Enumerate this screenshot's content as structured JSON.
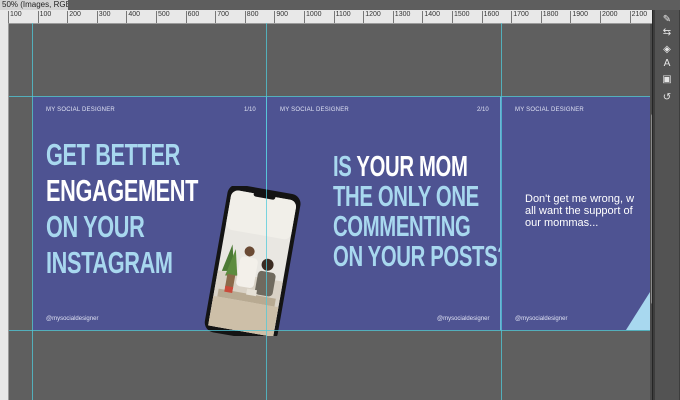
{
  "document_tab": {
    "title": "50% (Images, RGB/8*) *"
  },
  "ruler": {
    "labels": [
      "100",
      "100",
      "200",
      "300",
      "400",
      "500",
      "600",
      "700",
      "800",
      "900",
      "1000",
      "1100",
      "1200",
      "1300",
      "1400",
      "1500",
      "1600",
      "1700",
      "1800",
      "1900",
      "2000",
      "2100"
    ]
  },
  "slides": [
    {
      "brand": "MY SOCIAL DESIGNER",
      "page": "1/10",
      "headline": [
        "GET BETTER",
        "ENGAGEMENT",
        "ON YOUR",
        "INSTAGRAM"
      ],
      "handle": "@mysocialdesigner"
    },
    {
      "brand": "MY SOCIAL DESIGNER",
      "page": "2/10",
      "headline_parts": [
        "IS ",
        "YOUR MOM",
        "THE ONLY ONE",
        "COMMENTING",
        "ON YOUR POSTS?"
      ],
      "handle": "@mysocialdesigner"
    },
    {
      "brand": "MY SOCIAL DESIGNER",
      "body": [
        "Don't get me wrong, w",
        "all want the support of",
        "our mommas..."
      ],
      "handle": "@mysocialdesigner"
    }
  ],
  "colors": {
    "slide_bg": "#4e5392",
    "accent": "#a8d8ef",
    "guide": "#4fc9d9",
    "workspace": "#5f5f5f"
  },
  "tools": [
    "brush-icon",
    "adjust-icon",
    "layers-icon",
    "character-icon",
    "properties-icon",
    "history-icon"
  ]
}
